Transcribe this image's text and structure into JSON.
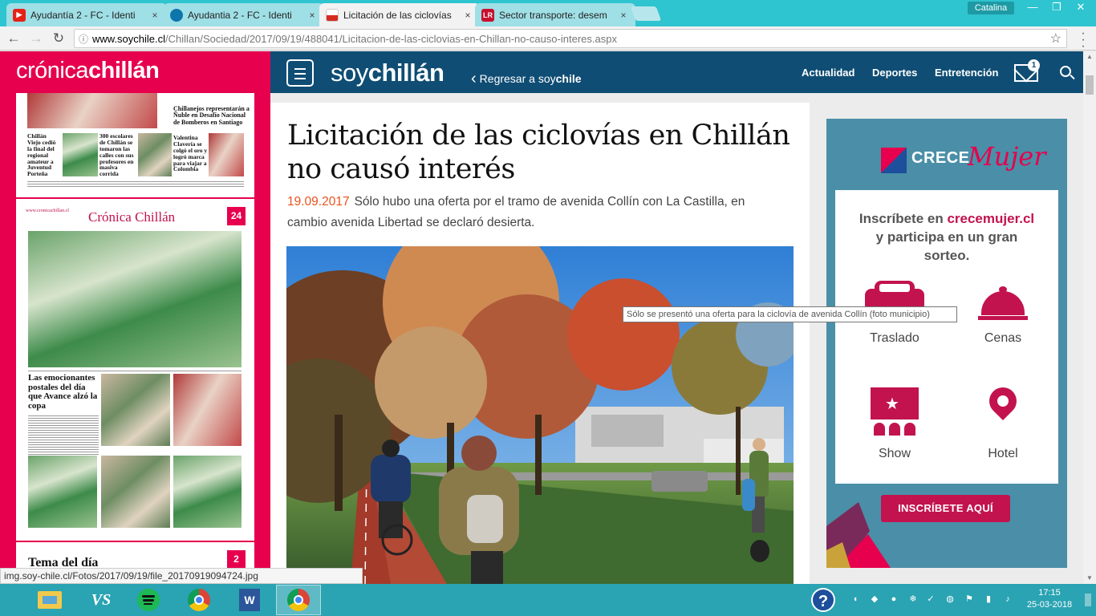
{
  "browser": {
    "tabs": [
      {
        "title": "Ayudantía 2 - FC - Identi",
        "favicon": "youtube-icon",
        "color": "#e62117"
      },
      {
        "title": "Ayudantia 2 - FC - Identi",
        "favicon": "drupal-icon",
        "color": "#0c76ab"
      },
      {
        "title": "Licitación de las ciclovías",
        "favicon": "chile-flag-icon",
        "color": "#d52b1e"
      },
      {
        "title": "Sector transporte: desem",
        "favicon": "lr-icon",
        "color": "#c8102e"
      }
    ],
    "tab_close_glyph": "×",
    "user": "Catalina",
    "window_buttons": [
      "—",
      "❐",
      "✕"
    ],
    "url_host": "www.soychile.cl",
    "url_path": "/Chillan/Sociedad/2017/09/19/488041/Licitacion-de-las-ciclovias-en-Chillan-no-causo-interes.aspx",
    "status_url": "img.soy-chile.cl/Fotos/2017/09/19/file_20170919094724.jpg"
  },
  "left": {
    "logo_light": "crónica",
    "logo_bold": "chillán",
    "page_badges": [
      "24",
      "2"
    ],
    "paper1": {
      "story_top": "Chillanejos representarán a Ñuble en Desafío Nacional de Bomberos en Santiago",
      "stories": [
        "Chillán Viejo cedió la final del regional amateur a Juventud Porteña",
        "300 escolares de Chillán se tomaron las calles con sus profesores en masiva corrida",
        "Valentina Clavería se colgó el oro y logró marca para viajar a Colombia"
      ]
    },
    "paper2": {
      "masthead": "Crónica Chillán",
      "url": "www.cronicachillan.cl",
      "headline": "Las emocionantes postales del día que Avance alzó la copa"
    },
    "paper3": {
      "headline": "Tema del día"
    }
  },
  "nav": {
    "logo_light": "soy",
    "logo_bold": "chillán",
    "back_arrow": "‹",
    "back_light": "Regresar a soy",
    "back_bold": "chile",
    "links": [
      "Actualidad",
      "Deportes",
      "Entretención"
    ],
    "mail_count": "1"
  },
  "article": {
    "headline": "Licitación de las ciclovías en Chillán no causó interés",
    "date": "19.09.2017",
    "lead": "Sólo hubo una oferta por el tramo de avenida Collín con La Castilla, en cambio avenida Libertad se declaró desierta.",
    "photo_tooltip": "Sólo se presentó una oferta para la ciclovía de avenida Collín (foto municipio)"
  },
  "ad": {
    "brand_a": "CRECE",
    "brand_b": "Mujer",
    "head_1": "Inscríbete en ",
    "head_hl": "crecemujer.cl",
    "head_2": "y participa en un gran sorteo.",
    "items": [
      "Traslado",
      "Cenas",
      "Show",
      "Hotel"
    ],
    "cta": "INSCRÍBETE AQUÍ",
    "accent": "#c2134f"
  },
  "taskbar": {
    "time": "17:15",
    "date": "25-03-2018"
  }
}
